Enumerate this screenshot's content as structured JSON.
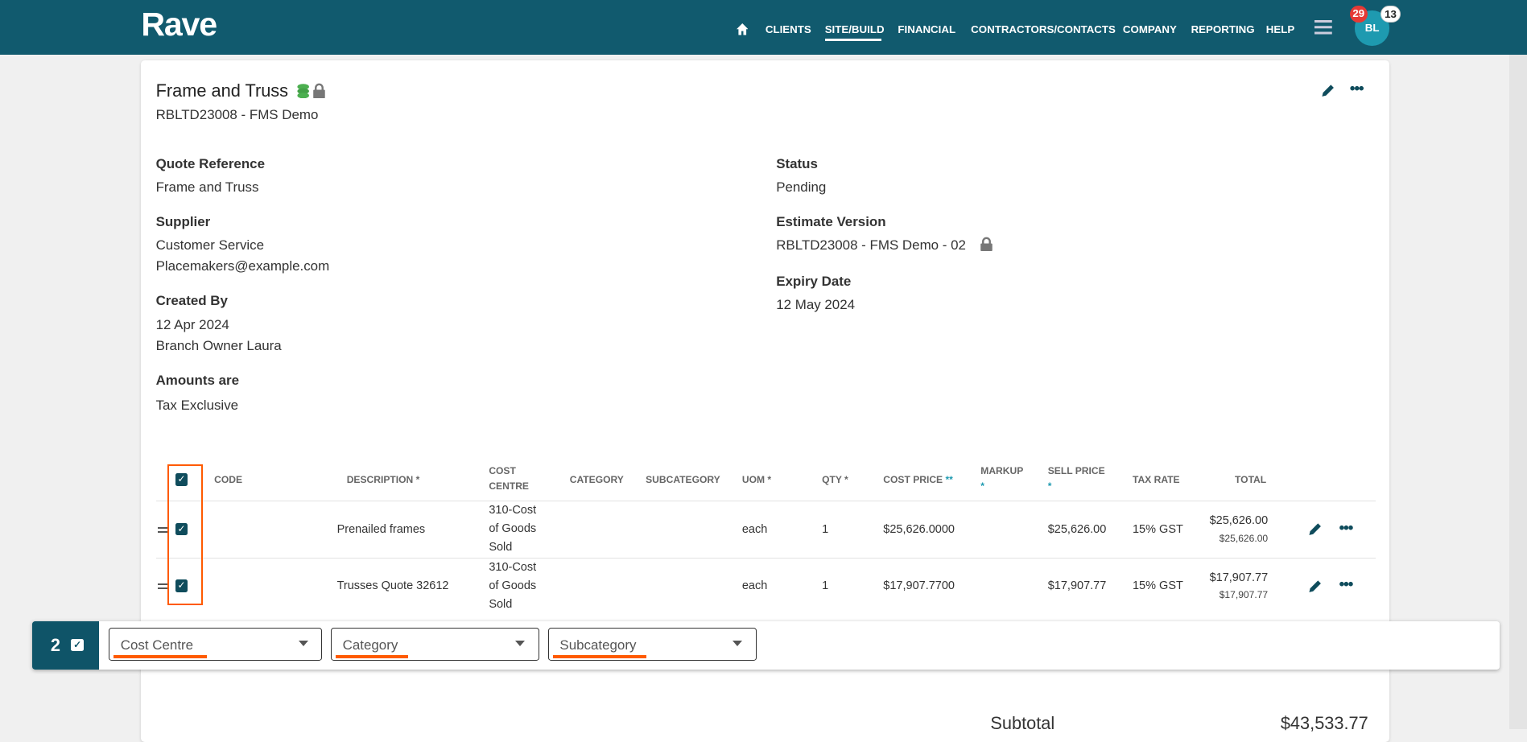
{
  "header": {
    "logo": "Rave",
    "nav": [
      "CLIENTS",
      "SITE/BUILD",
      "FINANCIAL",
      "CONTRACTORS/CONTACTS",
      "COMPANY",
      "REPORTING",
      "HELP"
    ],
    "active_nav": "SITE/BUILD",
    "avatar_initials": "BL",
    "notifications_badge": "29",
    "messages_badge": "13"
  },
  "quote": {
    "title": "Frame and Truss",
    "subtitle": "RBLTD23008 - FMS Demo",
    "fields_left": [
      {
        "label": "Quote Reference",
        "values": [
          "Frame and Truss"
        ]
      },
      {
        "label": "Supplier",
        "values": [
          "Customer Service",
          "Placemakers@example.com"
        ]
      },
      {
        "label": "Created By",
        "values": [
          "12 Apr 2024",
          "Branch Owner Laura"
        ]
      },
      {
        "label": "Amounts are",
        "values": [
          "Tax Exclusive"
        ]
      }
    ],
    "fields_right": [
      {
        "label": "Status",
        "values": [
          "Pending"
        ]
      },
      {
        "label": "Estimate Version",
        "values": [
          "RBLTD23008 - FMS Demo - 02"
        ]
      },
      {
        "label": "Expiry Date",
        "values": [
          "12 May 2024"
        ]
      }
    ]
  },
  "table": {
    "headers": {
      "code": "CODE",
      "description": "DESCRIPTION",
      "cost_centre_1": "COST",
      "cost_centre_2": "CENTRE",
      "category": "CATEGORY",
      "subcategory": "SUBCATEGORY",
      "uom": "UOM",
      "qty": "QTY",
      "cost_price": "COST PRICE",
      "markup": "MARKUP",
      "sell_price": "SELL PRICE",
      "tax_rate": "TAX RATE",
      "total": "TOTAL",
      "star": "*",
      "double_star": "**"
    },
    "rows": [
      {
        "description": "Prenailed frames",
        "cost_centre": [
          "310-Cost",
          "of Goods",
          "Sold"
        ],
        "uom": "each",
        "qty": "1",
        "cost_price": "$25,626.0000",
        "sell_price": "$25,626.00",
        "tax_rate": "15% GST",
        "total": "$25,626.00",
        "total_sub": "$25,626.00"
      },
      {
        "description": "Trusses Quote 32612",
        "cost_centre": [
          "310-Cost",
          "of Goods",
          "Sold"
        ],
        "uom": "each",
        "qty": "1",
        "cost_price": "$17,907.7700",
        "sell_price": "$17,907.77",
        "tax_rate": "15% GST",
        "total": "$17,907.77",
        "total_sub": "$17,907.77"
      }
    ]
  },
  "bulk_bar": {
    "selected_count": "2",
    "selects": [
      "Cost Centre",
      "Category",
      "Subcategory"
    ]
  },
  "summary": {
    "subtotal_label": "Subtotal",
    "subtotal_value": "$43,533.77"
  },
  "colors": {
    "header": "#115a6e",
    "accent": "#1e9ab0",
    "highlight": "#ff5a00",
    "badge": "#e53935"
  }
}
